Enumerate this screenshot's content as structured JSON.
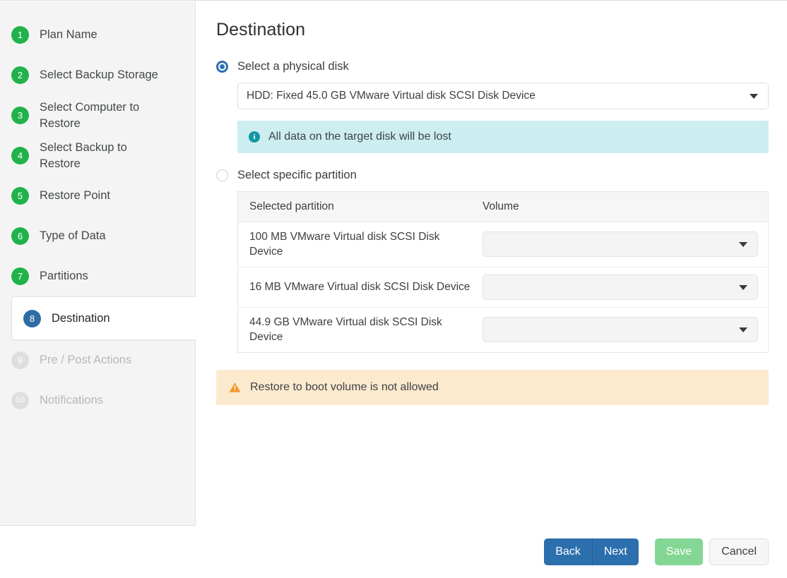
{
  "sidebar": {
    "steps": [
      {
        "num": "1",
        "label": "Plan Name",
        "state": "done"
      },
      {
        "num": "2",
        "label": "Select Backup Storage",
        "state": "done"
      },
      {
        "num": "3",
        "label": "Select Computer to Restore",
        "state": "done"
      },
      {
        "num": "4",
        "label": "Select Backup to Restore",
        "state": "done"
      },
      {
        "num": "5",
        "label": "Restore Point",
        "state": "done"
      },
      {
        "num": "6",
        "label": "Type of Data",
        "state": "done"
      },
      {
        "num": "7",
        "label": "Partitions",
        "state": "done"
      },
      {
        "num": "8",
        "label": "Destination",
        "state": "active"
      },
      {
        "num": "9",
        "label": "Pre / Post Actions",
        "state": "disabled"
      },
      {
        "num": "10",
        "label": "Notifications",
        "state": "disabled"
      }
    ]
  },
  "main": {
    "title": "Destination",
    "physical_disk": {
      "radio_label": "Select a physical disk",
      "selected": true,
      "value": "HDD: Fixed 45.0 GB VMware Virtual disk SCSI Disk Device",
      "caret_icon": "chevron-down-icon"
    },
    "info_alert": {
      "icon": "info-icon",
      "glyph": "i",
      "text": "All data on the target disk will be lost"
    },
    "specific_partition": {
      "radio_label": "Select specific partition",
      "selected": false
    },
    "table": {
      "headers": [
        "Selected partition",
        "Volume"
      ],
      "rows": [
        {
          "partition": "100 MB VMware Virtual disk SCSI Disk Device",
          "volume": ""
        },
        {
          "partition": "16 MB VMware Virtual disk SCSI Disk Device",
          "volume": ""
        },
        {
          "partition": "44.9 GB VMware Virtual disk SCSI Disk Device",
          "volume": ""
        }
      ]
    },
    "warn_alert": {
      "icon": "warning-triangle-icon",
      "text": "Restore to boot volume is not allowed"
    }
  },
  "footer": {
    "back_label": "Back",
    "next_label": "Next",
    "save_label": "Save",
    "cancel_label": "Cancel"
  },
  "colors": {
    "step_done": "#21b24b",
    "step_active": "#2e6ca4",
    "step_disabled": "#dfdfdf",
    "radio_selected": "#2c70b0",
    "info_bg": "#cdeef0",
    "info_icon": "#1196a6",
    "warn_bg": "#fceacf",
    "warn_icon": "#f39729",
    "primary_button": "#2c6fad",
    "save_button": "#84d694"
  }
}
